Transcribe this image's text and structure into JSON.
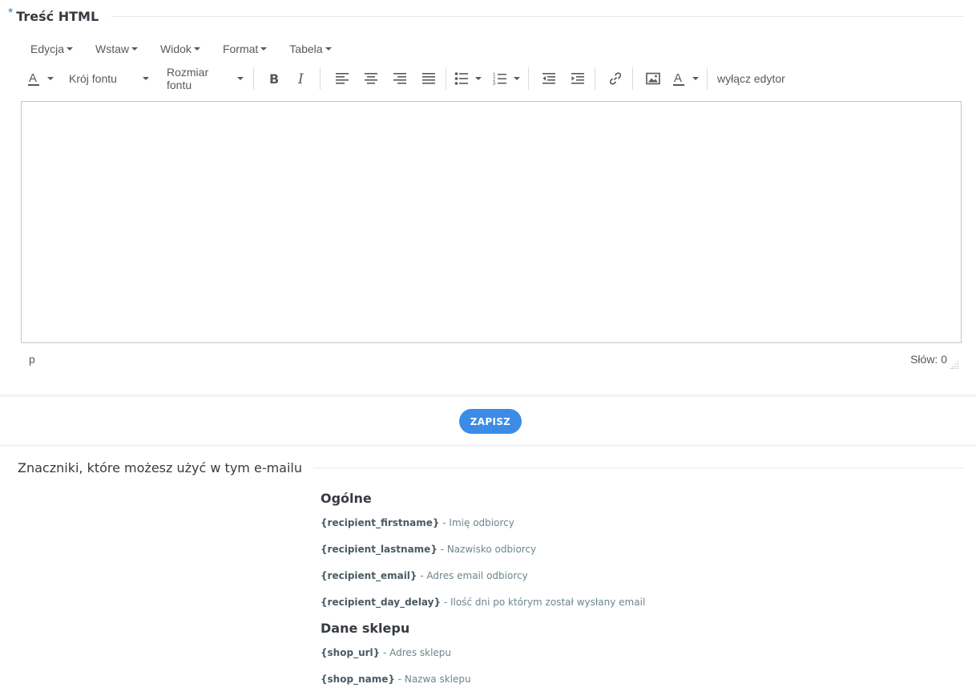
{
  "section": {
    "required_mark": "*",
    "title": "Treść HTML"
  },
  "menubar": [
    {
      "label": "Edycja"
    },
    {
      "label": "Wstaw"
    },
    {
      "label": "Widok"
    },
    {
      "label": "Format"
    },
    {
      "label": "Tabela"
    }
  ],
  "toolbar": {
    "font_family_label": "Krój fontu",
    "font_size_label": "Rozmiar fontu",
    "disable_editor_label": "wyłącz edytor",
    "icons": [
      "text-color-icon",
      "bold-icon",
      "italic-icon",
      "align-left-icon",
      "align-center-icon",
      "align-right-icon",
      "align-justify-icon",
      "bullet-list-icon",
      "numbered-list-icon",
      "outdent-icon",
      "indent-icon",
      "link-icon",
      "image-icon",
      "background-color-icon"
    ]
  },
  "statusbar": {
    "path": "p",
    "word_count": "Słów: 0"
  },
  "save_label": "ZAPISZ",
  "tags_section": {
    "title": "Znaczniki, które możesz użyć w tym e-mailu",
    "groups": [
      {
        "title": "Ogólne",
        "items": [
          {
            "code": "{recipient_firstname}",
            "desc": " - Imię odbiorcy"
          },
          {
            "code": "{recipient_lastname}",
            "desc": " - Nazwisko odbiorcy"
          },
          {
            "code": "{recipient_email}",
            "desc": " - Adres email odbiorcy"
          },
          {
            "code": "{recipient_day_delay}",
            "desc": " - Ilość dni po którym został wysłany email"
          }
        ]
      },
      {
        "title": "Dane sklepu",
        "items": [
          {
            "code": "{shop_url}",
            "desc": " - Adres sklepu"
          },
          {
            "code": "{shop_name}",
            "desc": " - Nazwa sklepu"
          }
        ]
      }
    ]
  }
}
